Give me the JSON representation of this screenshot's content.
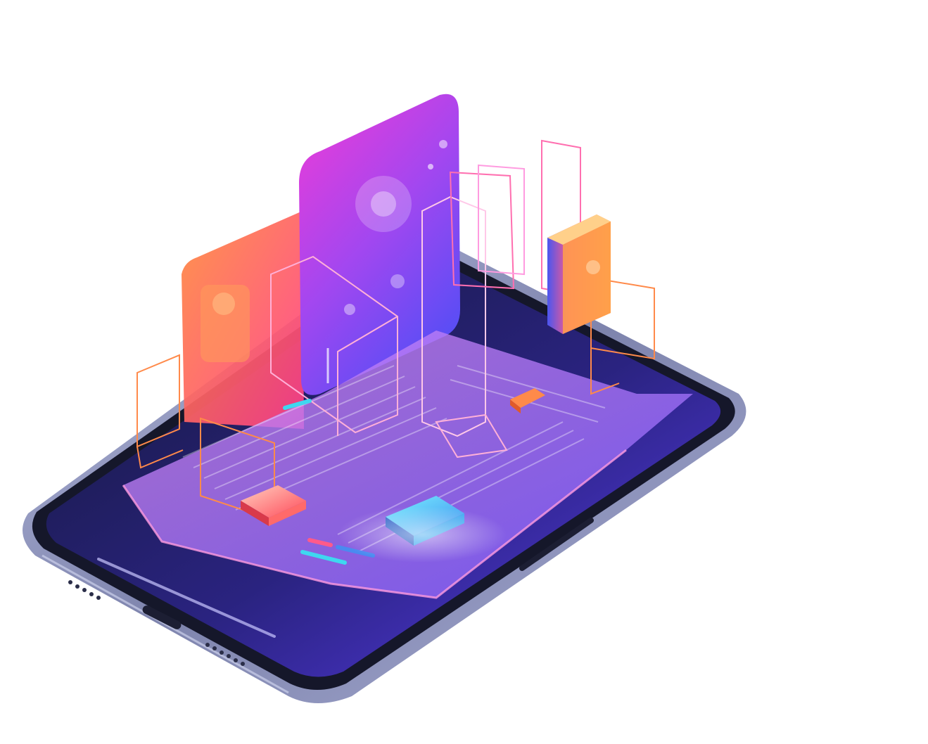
{
  "scene": {
    "subject": "isometric-smartphone-illustration",
    "background": "#ffffff",
    "colors": {
      "phone_frame": "#8a90b8",
      "phone_bezel": "#15172a",
      "screen_dark": "#1b1e48",
      "screen_glow": "#5a3cf0",
      "panel_pink": "#f23bd6",
      "panel_violet": "#6b4cf5",
      "card_orange": "#ff8a3c",
      "card_pink": "#ff3d8b",
      "wire_pink": "#ff6fb0",
      "wire_orange": "#ff8a4a",
      "chip_coral": "#ff5a5a",
      "chip_cyan": "#3ed7f0",
      "cube_orange": "#ffa04a",
      "cube_blue": "#4a56f0"
    },
    "icons": [
      "smartphone-icon",
      "speaker-grille-icon",
      "charging-port-icon",
      "side-button-icon"
    ]
  }
}
